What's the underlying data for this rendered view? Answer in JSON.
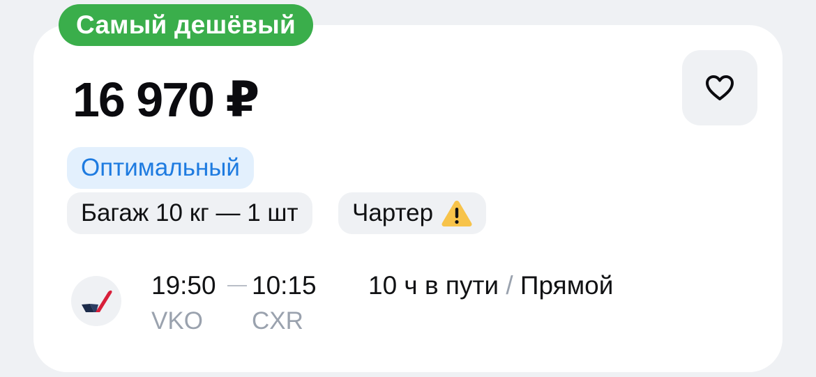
{
  "badge": {
    "label": "Самый дешёвый",
    "color": "#3aae4b"
  },
  "price": {
    "text": "16 970 ₽"
  },
  "favorite": {
    "icon": "heart-outline-icon"
  },
  "tags": {
    "optimal": "Оптимальный",
    "baggage": "Багаж 10 кг — 1 шт",
    "charter": "Чартер",
    "charter_icon": "warning-icon"
  },
  "flight": {
    "airline_logo": "airline-logo-icon",
    "departure_time": "19:50",
    "arrival_time": "10:15",
    "departure_code": "VKO",
    "arrival_code": "CXR",
    "duration": "10 ч в пути",
    "separator": "/",
    "stops": "Прямой"
  },
  "colors": {
    "accent_blue": "#1e7be0",
    "muted_gray": "#9aa2ae",
    "warning_yellow": "#f7c34a"
  }
}
